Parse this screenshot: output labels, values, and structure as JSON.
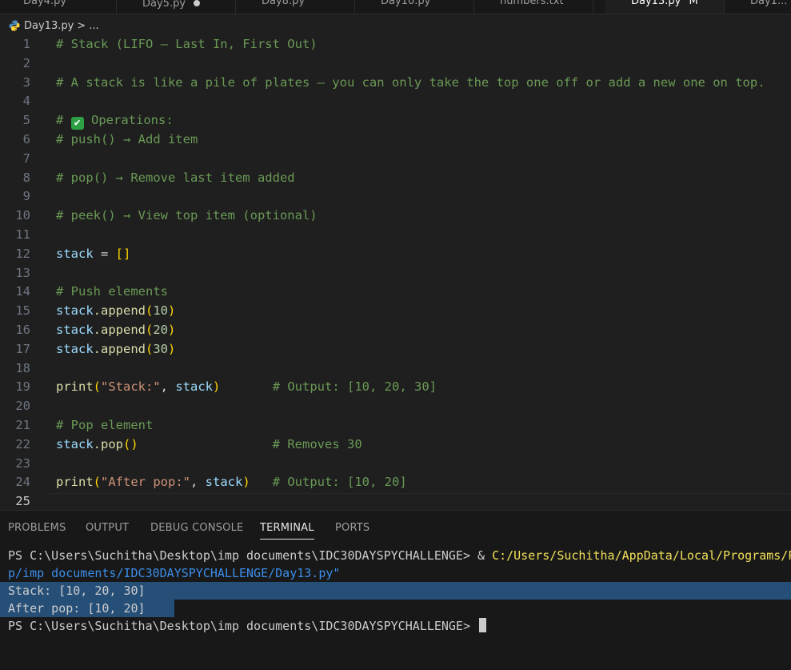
{
  "tabs": [
    {
      "label": "Day4.py",
      "active": false
    },
    {
      "label": "Day5.py",
      "active": false
    },
    {
      "label": "Day8.py",
      "active": false
    },
    {
      "label": "Day10.py",
      "active": false
    },
    {
      "label": "numbers.txt",
      "active": false
    },
    {
      "label": "Day13.py",
      "active": true,
      "badge": "M"
    },
    {
      "label": "Day1...",
      "active": false
    }
  ],
  "breadcrumb": {
    "file": "Day13.py",
    "separator": ">",
    "more": "..."
  },
  "editor": {
    "current_line": 25,
    "lines": [
      {
        "n": 1,
        "comment": "# Stack (LIFO – Last In, First Out)"
      },
      {
        "n": 2
      },
      {
        "n": 3,
        "comment": "# A stack is like a pile of plates – you can only take the top one off or add a new one on top."
      },
      {
        "n": 4
      },
      {
        "n": 5,
        "prefix": "# ",
        "emoji": "✔",
        "rest": " Operations:"
      },
      {
        "n": 6,
        "comment": "# push() → Add item"
      },
      {
        "n": 7
      },
      {
        "n": 8,
        "comment": "# pop() → Remove last item added"
      },
      {
        "n": 9
      },
      {
        "n": 10,
        "comment": "# peek() → View top item (optional)"
      },
      {
        "n": 11
      },
      {
        "n": 12,
        "var": "stack",
        "op": " = ",
        "br": "[]"
      },
      {
        "n": 13
      },
      {
        "n": 14,
        "comment": "# Push elements"
      },
      {
        "n": 15,
        "var": "stack",
        "fn": ".append",
        "open": "(",
        "num": "10",
        "close": ")"
      },
      {
        "n": 16,
        "var": "stack",
        "fn": ".append",
        "open": "(",
        "num": "20",
        "close": ")"
      },
      {
        "n": 17,
        "var": "stack",
        "fn": ".append",
        "open": "(",
        "num": "30",
        "close": ")"
      },
      {
        "n": 18
      },
      {
        "n": 19,
        "fn": "print",
        "open": "(",
        "str": "\"Stack:\"",
        "sep": ", ",
        "var2": "stack",
        "close": ")",
        "pad": "       ",
        "tail": "# Output: [10, 20, 30]"
      },
      {
        "n": 20
      },
      {
        "n": 21,
        "comment": "# Pop element"
      },
      {
        "n": 22,
        "var": "stack",
        "fn": ".pop",
        "open": "(",
        "close": ")",
        "pad": "                  ",
        "tail": "# Removes 30"
      },
      {
        "n": 23
      },
      {
        "n": 24,
        "fn": "print",
        "open": "(",
        "str": "\"After pop:\"",
        "sep": ", ",
        "var2": "stack",
        "close": ")",
        "pad": "   ",
        "tail": "# Output: [10, 20]"
      },
      {
        "n": 25
      }
    ]
  },
  "panel": {
    "tabs": [
      "PROBLEMS",
      "OUTPUT",
      "DEBUG CONSOLE",
      "TERMINAL",
      "PORTS"
    ],
    "active_tab": "TERMINAL"
  },
  "terminal": {
    "prompt_1": "PS C:\\Users\\Suchitha\\Desktop\\imp documents\\IDC30DAYSPYCHALLENGE> ",
    "amp": "& ",
    "cmd_path": "C:/Users/Suchitha/AppData/Local/Programs/P",
    "cmd_cont": "p/imp documents/IDC30DAYSPYCHALLENGE/Day13.py\"",
    "out_1": "Stack: [10, 20, 30]",
    "out_2": "After pop: [10, 20]",
    "prompt_2": "PS C:\\Users\\Suchitha\\Desktop\\imp documents\\IDC30DAYSPYCHALLENGE> "
  }
}
